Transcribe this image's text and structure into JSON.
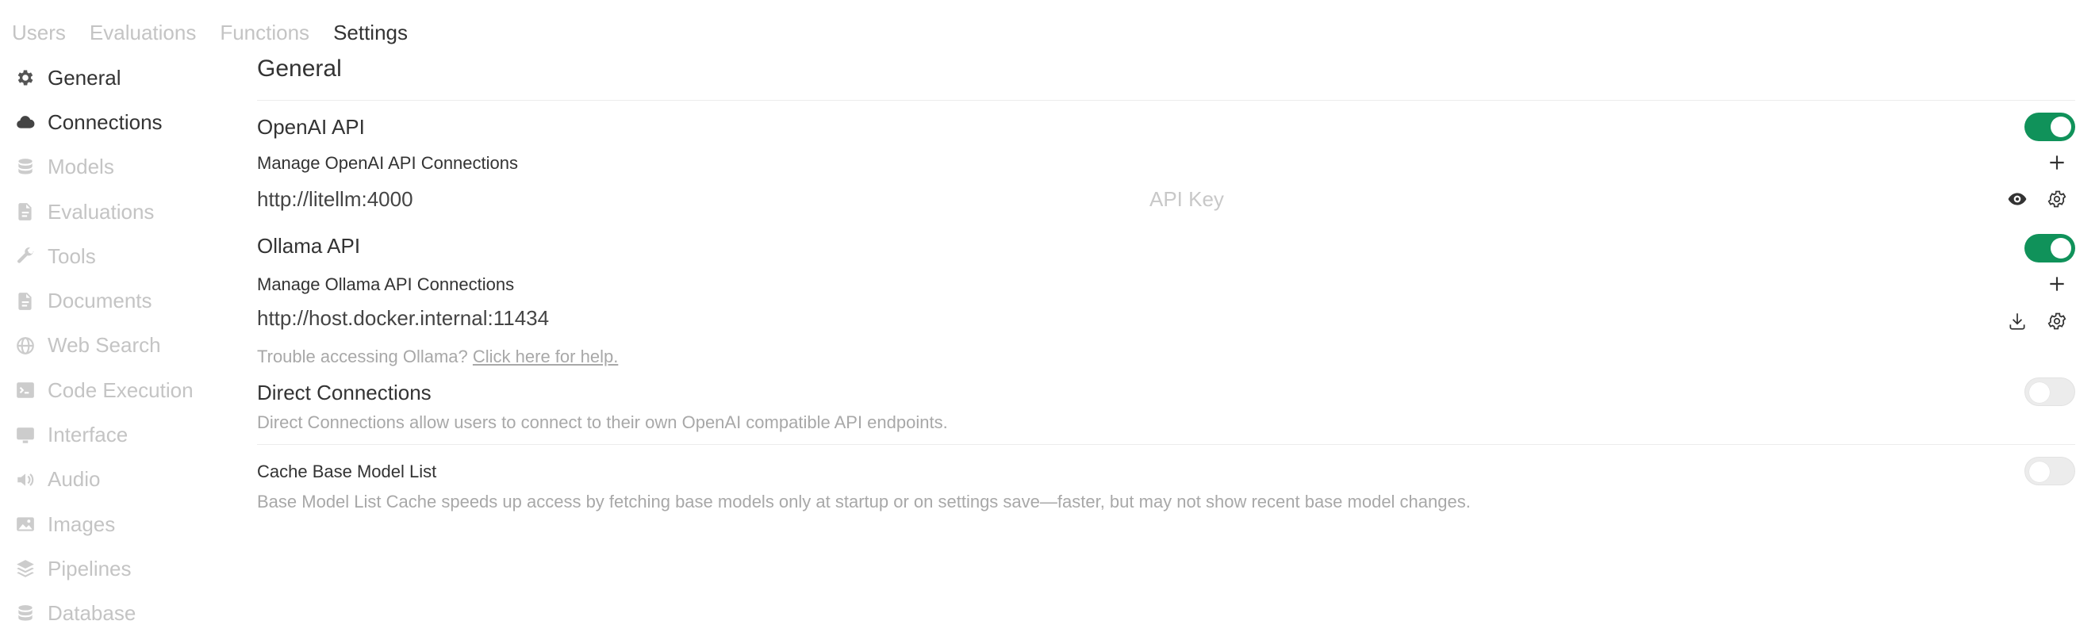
{
  "topnav": {
    "tabs": [
      {
        "label": "Users"
      },
      {
        "label": "Evaluations"
      },
      {
        "label": "Functions"
      },
      {
        "label": "Settings"
      }
    ]
  },
  "sidebar": {
    "items": [
      {
        "label": "General",
        "icon": "gear-icon"
      },
      {
        "label": "Connections",
        "icon": "cloud-icon"
      },
      {
        "label": "Models",
        "icon": "database-icon"
      },
      {
        "label": "Evaluations",
        "icon": "document-icon"
      },
      {
        "label": "Tools",
        "icon": "wrench-icon"
      },
      {
        "label": "Documents",
        "icon": "document-icon"
      },
      {
        "label": "Web Search",
        "icon": "globe-icon"
      },
      {
        "label": "Code Execution",
        "icon": "terminal-icon"
      },
      {
        "label": "Interface",
        "icon": "monitor-icon"
      },
      {
        "label": "Audio",
        "icon": "speaker-icon"
      },
      {
        "label": "Images",
        "icon": "image-icon"
      },
      {
        "label": "Pipelines",
        "icon": "layers-icon"
      },
      {
        "label": "Database",
        "icon": "database-icon"
      }
    ]
  },
  "main": {
    "title": "General",
    "openai": {
      "label": "OpenAI API",
      "enabled": true,
      "manage_label": "Manage OpenAI API Connections",
      "url": "http://litellm:4000",
      "key_placeholder": "API Key"
    },
    "ollama": {
      "label": "Ollama API",
      "enabled": true,
      "manage_label": "Manage Ollama API Connections",
      "url": "http://host.docker.internal:11434",
      "help_text": "Trouble accessing Ollama?",
      "help_link": "Click here for help."
    },
    "direct": {
      "label": "Direct Connections",
      "enabled": false,
      "description": "Direct Connections allow users to connect to their own OpenAI compatible API endpoints."
    },
    "cache": {
      "label": "Cache Base Model List",
      "enabled": false,
      "description": "Base Model List Cache speeds up access by fetching base models only at startup or on settings save—faster, but may not show recent base model changes."
    }
  },
  "colors": {
    "accent": "#10925a",
    "text": "#333333",
    "muted": "#a8a8a8",
    "inactive_nav": "#c4c4c4"
  }
}
